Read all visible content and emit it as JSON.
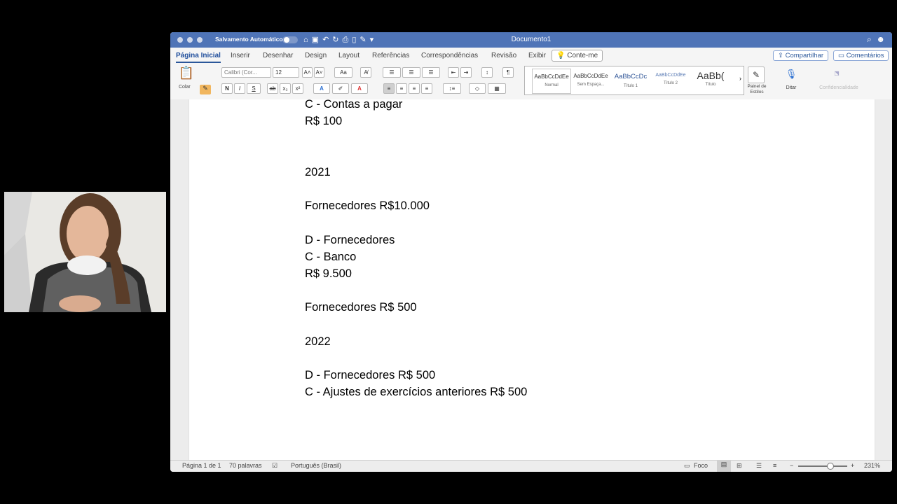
{
  "titlebar": {
    "autosave_label": "Salvamento Automático",
    "document_title": "Documento1"
  },
  "tabs": [
    "Página Inicial",
    "Inserir",
    "Desenhar",
    "Design",
    "Layout",
    "Referências",
    "Correspondências",
    "Revisão",
    "Exibir"
  ],
  "tell_me": "Conte-me",
  "share_label": "Compartilhar",
  "comments_label": "Comentários",
  "ribbon": {
    "paste_label": "Colar",
    "font_name": "Calibri (Cor...",
    "font_size": "12",
    "case_label": "Aa",
    "format_buttons": [
      "N",
      "I",
      "S",
      "ab",
      "x₂",
      "x²"
    ],
    "styles": [
      {
        "preview": "AaBbCcDdEe",
        "name": "Normal"
      },
      {
        "preview": "AaBbCcDdEe",
        "name": "Sem Espaça..."
      },
      {
        "preview": "AaBbCcDc",
        "name": "Título 1"
      },
      {
        "preview": "AaBbCcDdEe",
        "name": "Título 2"
      },
      {
        "preview": "AaBb(",
        "name": "Título"
      }
    ],
    "styles_pane_label": "Painel de Estilos",
    "dictate_label": "Ditar",
    "sensitivity_label": "Confidencialidade"
  },
  "document": {
    "lines": [
      "C - Contas a pagar",
      "R$ 100",
      "",
      "",
      "2021",
      "",
      "Fornecedores R$10.000",
      "",
      "D - Fornecedores",
      "C - Banco",
      "R$ 9.500",
      "",
      "Fornecedores R$ 500",
      "",
      "2022",
      "",
      "D - Fornecedores R$ 500",
      "C - Ajustes de exercícios anteriores R$ 500"
    ]
  },
  "statusbar": {
    "page": "Página 1 de 1",
    "words": "70 palavras",
    "language": "Português (Brasil)",
    "focus": "Foco",
    "zoom": "231%"
  },
  "colors": {
    "titlebar": "#4f74b7",
    "accent": "#2b579a"
  }
}
